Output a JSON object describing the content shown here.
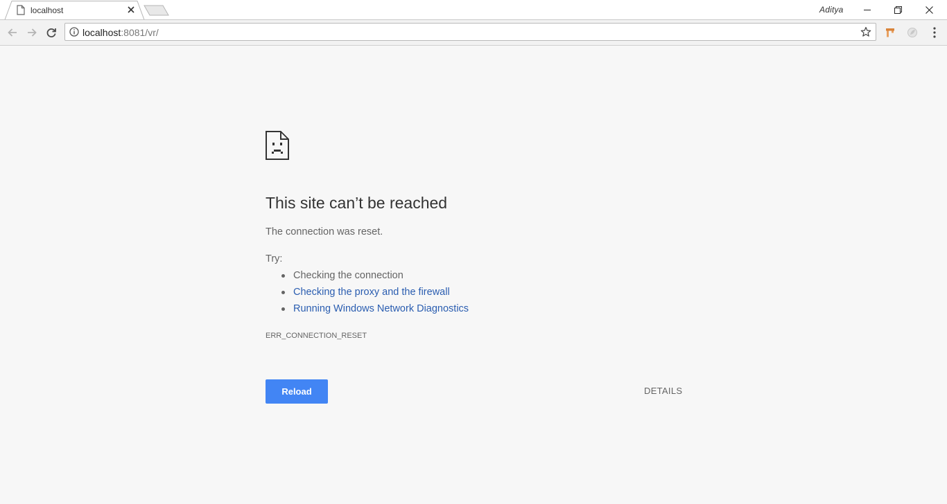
{
  "browser": {
    "tab": {
      "title": "localhost"
    },
    "profile_name": "Aditya",
    "address": {
      "host": "localhost",
      "rest": ":8081/vr/"
    }
  },
  "error_page": {
    "heading": "This site can’t be reached",
    "subtext": "The connection was reset.",
    "try_label": "Try:",
    "suggestions": [
      {
        "text": "Checking the connection",
        "is_link": false
      },
      {
        "text": "Checking the proxy and the firewall",
        "is_link": true
      },
      {
        "text": "Running Windows Network Diagnostics",
        "is_link": true
      }
    ],
    "error_code": "ERR_CONNECTION_RESET",
    "reload_label": "Reload",
    "details_label": "DETAILS"
  },
  "icons": {
    "tab_favicon": "page-icon",
    "error_illustration": "sad-page-icon",
    "site_info": "info-icon",
    "bookmark": "star-icon"
  },
  "colors": {
    "accent": "#4285f4",
    "link": "#2a5db0",
    "page_background": "#f7f7f7"
  }
}
